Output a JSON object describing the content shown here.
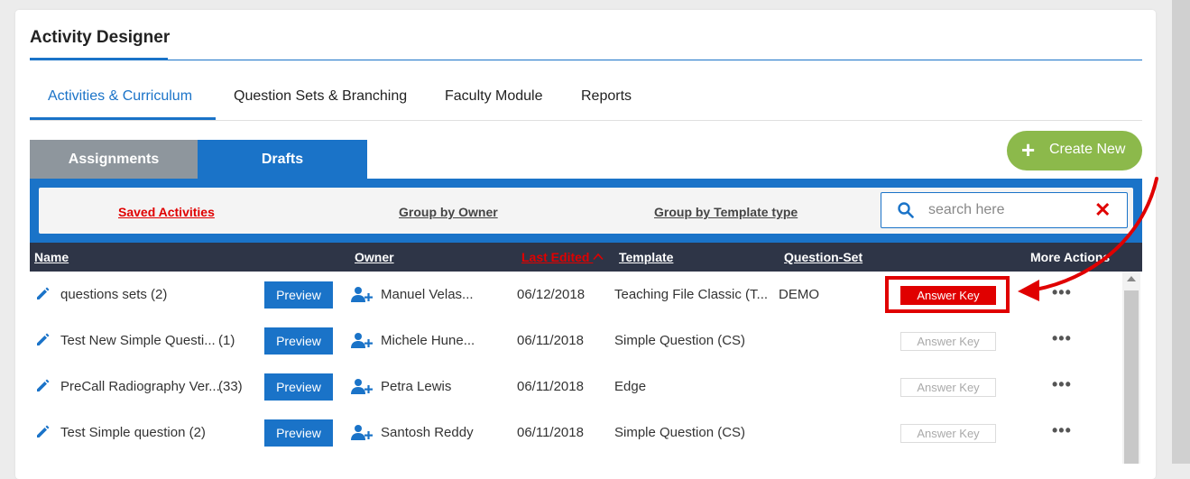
{
  "page": {
    "title": "Activity Designer"
  },
  "tabs": [
    {
      "label": "Activities & Curriculum",
      "active": true
    },
    {
      "label": "Question Sets & Branching"
    },
    {
      "label": "Faculty Module"
    },
    {
      "label": "Reports"
    }
  ],
  "subtabs": {
    "assignments": "Assignments",
    "drafts": "Drafts"
  },
  "create_new": {
    "label": "Create New",
    "icon": "plus-icon"
  },
  "filters": {
    "saved": "Saved Activities",
    "by_owner": "Group by Owner",
    "by_template": "Group by Template type"
  },
  "search": {
    "placeholder": "search here",
    "value": ""
  },
  "columns": {
    "name": "Name",
    "owner": "Owner",
    "last_edited": "Last Edited",
    "template": "Template",
    "question_set": "Question-Set",
    "more_actions": "More Actions"
  },
  "buttons": {
    "preview": "Preview",
    "answer_key": "Answer Key"
  },
  "rows": [
    {
      "name": "questions sets (2)",
      "count": "",
      "owner": "Manuel Velas...",
      "date": "06/12/2018",
      "template": "Teaching File Classic (T...",
      "question_set": "DEMO",
      "answer_key_active": true
    },
    {
      "name": "Test New Simple Questi...",
      "count": "(1)",
      "owner": "Michele Hune...",
      "date": "06/11/2018",
      "template": "Simple Question (CS)",
      "question_set": "",
      "answer_key_active": false
    },
    {
      "name": "PreCall Radiography Ver...",
      "count": "(33)",
      "owner": "Petra Lewis",
      "date": "06/11/2018",
      "template": "Edge",
      "question_set": "",
      "answer_key_active": false
    },
    {
      "name": "Test Simple question (2)",
      "count": "",
      "owner": "Santosh Reddy",
      "date": "06/11/2018",
      "template": "Simple Question (CS)",
      "question_set": "",
      "answer_key_active": false
    }
  ],
  "colors": {
    "accent": "#1a73c8",
    "danger": "#e00000",
    "create": "#8cb94b",
    "header": "#2e3547"
  }
}
